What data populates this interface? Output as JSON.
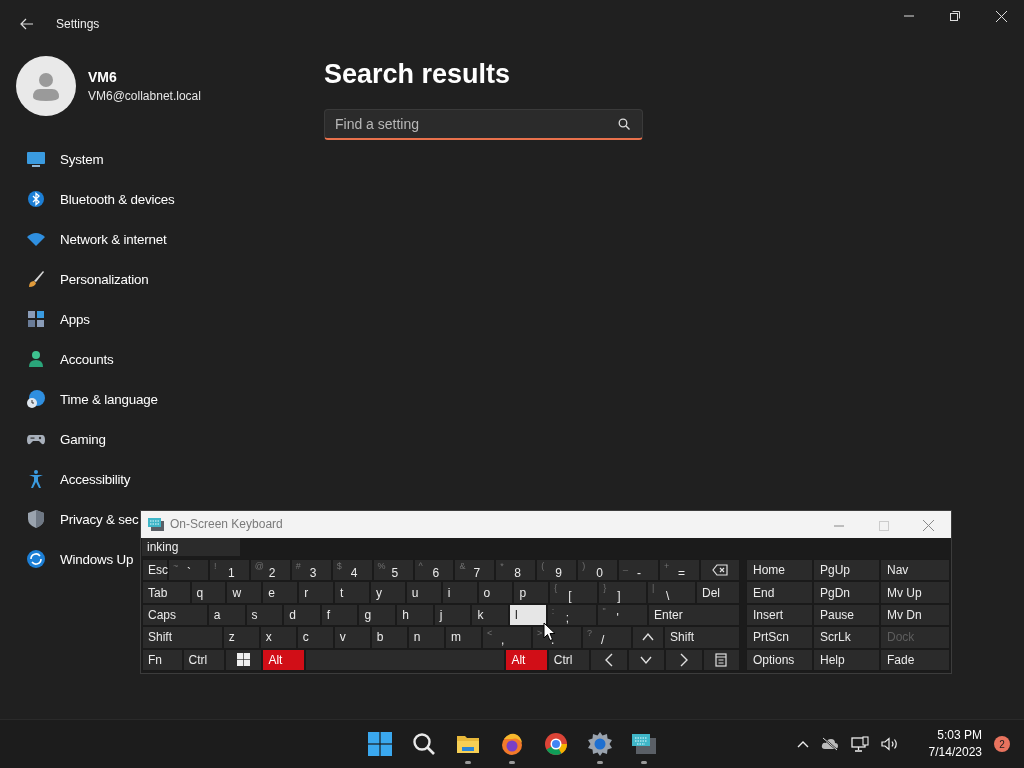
{
  "settings": {
    "window_title": "Settings",
    "user": {
      "name": "VM6",
      "email": "VM6@collabnet.local"
    },
    "nav": [
      {
        "label": "System",
        "selected": false
      },
      {
        "label": "Bluetooth & devices",
        "selected": false
      },
      {
        "label": "Network & internet",
        "selected": false
      },
      {
        "label": "Personalization",
        "selected": false
      },
      {
        "label": "Apps",
        "selected": false
      },
      {
        "label": "Accounts",
        "selected": false
      },
      {
        "label": "Time & language",
        "selected": false
      },
      {
        "label": "Gaming",
        "selected": false
      },
      {
        "label": "Accessibility",
        "selected": false
      },
      {
        "label": "Privacy & sec",
        "selected": false
      },
      {
        "label": "Windows Up",
        "selected": false
      }
    ],
    "page_title": "Search results",
    "search": {
      "placeholder": "Find a setting"
    }
  },
  "keyboard": {
    "title": "On-Screen Keyboard",
    "prediction": "inking",
    "rows": [
      {
        "keys": [
          {
            "kind": "key",
            "label": "Esc",
            "pressed": false,
            "hovered": false
          },
          {
            "kind": "key",
            "shift": "~",
            "label": "`",
            "pressed": false,
            "hovered": false
          },
          {
            "kind": "key",
            "shift": "!",
            "label": "1",
            "pressed": false,
            "hovered": false
          },
          {
            "kind": "key",
            "shift": "@",
            "label": "2",
            "pressed": false,
            "hovered": false
          },
          {
            "kind": "key",
            "shift": "#",
            "label": "3",
            "pressed": false,
            "hovered": false
          },
          {
            "kind": "key",
            "shift": "$",
            "label": "4",
            "pressed": false,
            "hovered": false
          },
          {
            "kind": "key",
            "shift": "%",
            "label": "5",
            "pressed": false,
            "hovered": false
          },
          {
            "kind": "key",
            "shift": "^",
            "label": "6",
            "pressed": false,
            "hovered": false
          },
          {
            "kind": "key",
            "shift": "&",
            "label": "7",
            "pressed": false,
            "hovered": false
          },
          {
            "kind": "key",
            "shift": "*",
            "label": "8",
            "pressed": false,
            "hovered": false
          },
          {
            "kind": "key",
            "shift": "(",
            "label": "9",
            "pressed": false,
            "hovered": false
          },
          {
            "kind": "key",
            "shift": ")",
            "label": "0",
            "pressed": false,
            "hovered": false
          },
          {
            "kind": "key",
            "shift": "_",
            "label": "-",
            "pressed": false,
            "hovered": false
          },
          {
            "kind": "key",
            "shift": "+",
            "label": "=",
            "pressed": false,
            "hovered": false
          },
          {
            "kind": "backspace",
            "pressed": false,
            "hovered": false
          }
        ]
      },
      {
        "keys": [
          {
            "kind": "key",
            "label": "Tab",
            "pressed": false,
            "hovered": false
          },
          {
            "kind": "key",
            "label": "q",
            "pressed": false,
            "hovered": false
          },
          {
            "kind": "key",
            "label": "w",
            "pressed": false,
            "hovered": false
          },
          {
            "kind": "key",
            "label": "e",
            "pressed": false,
            "hovered": false
          },
          {
            "kind": "key",
            "label": "r",
            "pressed": false,
            "hovered": false
          },
          {
            "kind": "key",
            "label": "t",
            "pressed": false,
            "hovered": false
          },
          {
            "kind": "key",
            "label": "y",
            "pressed": false,
            "hovered": false
          },
          {
            "kind": "key",
            "label": "u",
            "pressed": false,
            "hovered": false
          },
          {
            "kind": "key",
            "label": "i",
            "pressed": false,
            "hovered": false
          },
          {
            "kind": "key",
            "label": "o",
            "pressed": false,
            "hovered": false
          },
          {
            "kind": "key",
            "label": "p",
            "pressed": false,
            "hovered": false
          },
          {
            "kind": "key",
            "shift": "{",
            "label": "[",
            "pressed": false,
            "hovered": false
          },
          {
            "kind": "key",
            "shift": "}",
            "label": "]",
            "pressed": false,
            "hovered": false
          },
          {
            "kind": "key",
            "shift": "|",
            "label": "\\",
            "pressed": false,
            "hovered": false
          },
          {
            "kind": "key",
            "label": "Del",
            "pressed": false,
            "hovered": false
          }
        ]
      },
      {
        "keys": [
          {
            "kind": "key",
            "label": "Caps",
            "pressed": false,
            "hovered": false
          },
          {
            "kind": "key",
            "label": "a",
            "pressed": false,
            "hovered": false
          },
          {
            "kind": "key",
            "label": "s",
            "pressed": false,
            "hovered": false
          },
          {
            "kind": "key",
            "label": "d",
            "pressed": false,
            "hovered": false
          },
          {
            "kind": "key",
            "label": "f",
            "pressed": false,
            "hovered": false
          },
          {
            "kind": "key",
            "label": "g",
            "pressed": false,
            "hovered": false
          },
          {
            "kind": "key",
            "label": "h",
            "pressed": false,
            "hovered": false
          },
          {
            "kind": "key",
            "label": "j",
            "pressed": false,
            "hovered": false
          },
          {
            "kind": "key",
            "label": "k",
            "pressed": false,
            "hovered": false
          },
          {
            "kind": "key",
            "label": "l",
            "pressed": false,
            "hovered": true
          },
          {
            "kind": "key",
            "shift": ":",
            "label": ";",
            "pressed": false,
            "hovered": false
          },
          {
            "kind": "key",
            "shift": "\"",
            "label": "'",
            "pressed": false,
            "hovered": false
          },
          {
            "kind": "key",
            "label": "Enter",
            "pressed": false,
            "hovered": false
          }
        ]
      },
      {
        "keys": [
          {
            "kind": "key",
            "label": "Shift",
            "pressed": false,
            "hovered": false
          },
          {
            "kind": "key",
            "label": "z",
            "pressed": false,
            "hovered": false
          },
          {
            "kind": "key",
            "label": "x",
            "pressed": false,
            "hovered": false
          },
          {
            "kind": "key",
            "label": "c",
            "pressed": false,
            "hovered": false
          },
          {
            "kind": "key",
            "label": "v",
            "pressed": false,
            "hovered": false
          },
          {
            "kind": "key",
            "label": "b",
            "pressed": false,
            "hovered": false
          },
          {
            "kind": "key",
            "label": "n",
            "pressed": false,
            "hovered": false
          },
          {
            "kind": "key",
            "label": "m",
            "pressed": false,
            "hovered": false
          },
          {
            "kind": "key",
            "shift": "<",
            "label": ",",
            "pressed": false,
            "hovered": false
          },
          {
            "kind": "key",
            "shift": ">",
            "label": ".",
            "pressed": false,
            "hovered": false
          },
          {
            "kind": "key",
            "shift": "?",
            "label": "/",
            "pressed": false,
            "hovered": false
          },
          {
            "kind": "up",
            "pressed": false,
            "hovered": false
          },
          {
            "kind": "key",
            "label": "Shift",
            "pressed": false,
            "hovered": false
          }
        ]
      },
      {
        "keys": [
          {
            "kind": "key",
            "label": "Fn",
            "pressed": false,
            "hovered": false
          },
          {
            "kind": "key",
            "label": "Ctrl",
            "pressed": false,
            "hovered": false
          },
          {
            "kind": "windows",
            "pressed": false,
            "hovered": false
          },
          {
            "kind": "key",
            "label": "Alt",
            "pressed": true,
            "hovered": false
          },
          {
            "kind": "space",
            "pressed": false,
            "hovered": false
          },
          {
            "kind": "key",
            "label": "Alt",
            "pressed": true,
            "hovered": false
          },
          {
            "kind": "key",
            "label": "Ctrl",
            "pressed": false,
            "hovered": false
          },
          {
            "kind": "left",
            "pressed": false,
            "hovered": false
          },
          {
            "kind": "down",
            "pressed": false,
            "hovered": false
          },
          {
            "kind": "right",
            "pressed": false,
            "hovered": false
          },
          {
            "kind": "menu",
            "pressed": false,
            "hovered": false
          }
        ]
      }
    ],
    "nav_keys": [
      {
        "label": "Home",
        "disabled": false
      },
      {
        "label": "PgUp",
        "disabled": false
      },
      {
        "label": "Nav",
        "disabled": false
      },
      {
        "label": "End",
        "disabled": false
      },
      {
        "label": "PgDn",
        "disabled": false
      },
      {
        "label": "Mv Up",
        "disabled": false
      },
      {
        "label": "Insert",
        "disabled": false
      },
      {
        "label": "Pause",
        "disabled": false
      },
      {
        "label": "Mv Dn",
        "disabled": false
      },
      {
        "label": "PrtScn",
        "disabled": false
      },
      {
        "label": "ScrLk",
        "disabled": false
      },
      {
        "label": "Dock",
        "disabled": true
      },
      {
        "label": "Options",
        "disabled": false
      },
      {
        "label": "Help",
        "disabled": false
      },
      {
        "label": "Fade",
        "disabled": false
      }
    ]
  },
  "taskbar": {
    "apps": [
      {
        "kind": "start",
        "running": false
      },
      {
        "kind": "search",
        "running": false
      },
      {
        "kind": "explorer",
        "running": true
      },
      {
        "kind": "firefox",
        "running": true
      },
      {
        "kind": "chrome",
        "running": false
      },
      {
        "kind": "settings",
        "running": true
      },
      {
        "kind": "keyboard",
        "running": true
      }
    ],
    "time": "5:03 PM",
    "date": "7/14/2023",
    "notifications": "2"
  }
}
